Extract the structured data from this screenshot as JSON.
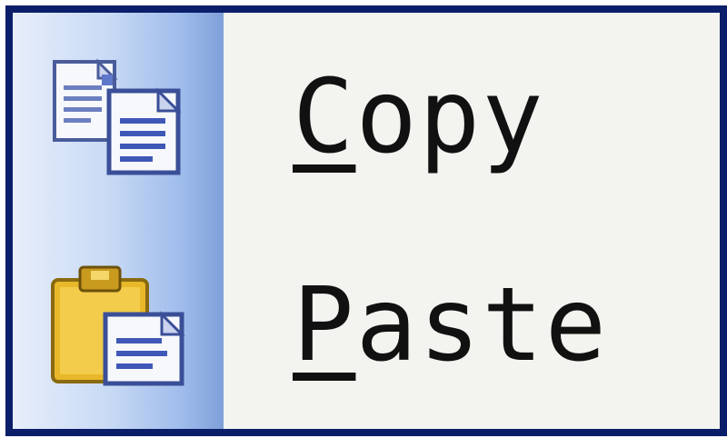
{
  "menu": {
    "items": [
      {
        "mnemonic": "C",
        "rest": "opy",
        "icon": "copy-icon"
      },
      {
        "mnemonic": "P",
        "rest": "aste",
        "icon": "paste-icon"
      }
    ]
  },
  "colors": {
    "border": "#0b1e6a",
    "menu_bg": "#f3f3f0",
    "gutter_light": "#e7eefb",
    "gutter_dark": "#7f9fd9"
  }
}
